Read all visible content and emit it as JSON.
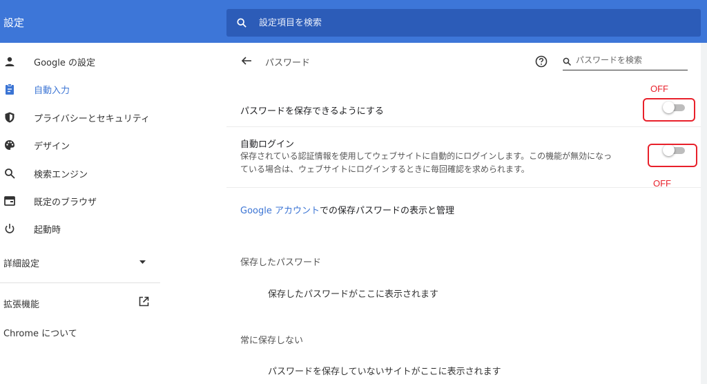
{
  "header": {
    "title": "設定",
    "search_placeholder": "設定項目を検索",
    "accent_color": "#3d76d8"
  },
  "sidebar": {
    "items": [
      {
        "label": "Google の設定",
        "icon": "person-icon"
      },
      {
        "label": "自動入力",
        "icon": "clipboard-icon",
        "active": true
      },
      {
        "label": "プライバシーとセキュリティ",
        "icon": "shield-icon"
      },
      {
        "label": "デザイン",
        "icon": "palette-icon"
      },
      {
        "label": "検索エンジン",
        "icon": "search-icon"
      },
      {
        "label": "既定のブラウザ",
        "icon": "browser-icon"
      },
      {
        "label": "起動時",
        "icon": "power-icon"
      }
    ],
    "advanced": "詳細設定",
    "extensions": "拡張機能",
    "about": "Chrome について"
  },
  "main": {
    "title": "パスワード",
    "search_placeholder": "パスワードを検索",
    "offer_save": {
      "label": "パスワードを保存できるようにする",
      "enabled": false
    },
    "auto_signin": {
      "label": "自動ログイン",
      "desc_line1": "保存されている認証情報を使用してウェブサイトに自動的にログインします。この機能が無効になっ",
      "desc_line2": "ている場合は、ウェブサイトにログインするときに毎回確認を求められます。",
      "enabled": false
    },
    "manage_link_prefix": "Google アカウント",
    "manage_link_suffix": "での保存パスワードの表示と管理",
    "saved_heading": "保存したパスワード",
    "saved_empty": "保存したパスワードがここに表示されます",
    "never_heading": "常に保存しない",
    "never_empty": "パスワードを保存していないサイトがここに表示されます"
  },
  "annotations": {
    "off_top": "OFF",
    "off_bottom": "OFF",
    "color": "#e8202a"
  }
}
